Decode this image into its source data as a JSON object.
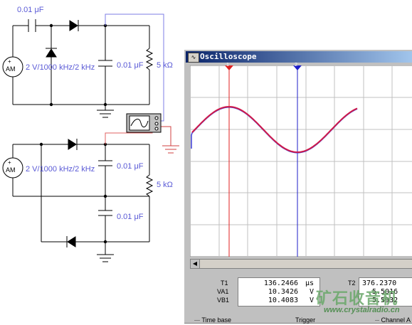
{
  "colors": {
    "wire": "#000000",
    "probe_wire": "#7d7de6",
    "probe_wire_red": "#e06060",
    "ground_red": "#d04040",
    "label": "#5a5ad6",
    "screen_bg": "#ffffff",
    "grid": "#c0c0c0",
    "cursor1": "#e02020",
    "cursor2": "#1e1ec8",
    "trace": "#d01a4a"
  },
  "circuit_top": {
    "coupling_cap": "0.01 μF",
    "source_label": "2 V/1000 kHz/2 kHz",
    "source_symbol_plus": "+",
    "source_symbol_name": "AM",
    "filter_cap": "0.01 μF",
    "load_resistor": "5 kΩ"
  },
  "circuit_bottom": {
    "source_label": "2 V/1000 kHz/2 kHz",
    "source_symbol_plus": "+",
    "source_symbol_name": "AM",
    "cap_upper": "0.01 μF",
    "cap_lower": "0.01 μF",
    "load_resistor": "5 kΩ"
  },
  "oscilloscope": {
    "title": "Oscilloscope",
    "icon_name": "oscilloscope-icon",
    "cursor1_label": "1",
    "cursor2_label": "2",
    "readout": {
      "t1_label": "T1",
      "t1_value": "136.2466",
      "t1_unit": "μs",
      "va1_label": "VA1",
      "va1_value": "10.3426",
      "va1_unit": "V",
      "vb1_label": "VB1",
      "vb1_value": "10.4083",
      "vb1_unit": "V",
      "t2_label": "T2",
      "t2_value": "376.2370",
      "va2_value": "5.5016",
      "vb2_value": "5.5932"
    },
    "bottom_labels": {
      "time_base": "Time base",
      "trigger": "Trigger",
      "channel_a": "Channel A"
    }
  },
  "watermark": {
    "text": "矿石收音机",
    "url": "www.crystalradio.cn"
  }
}
